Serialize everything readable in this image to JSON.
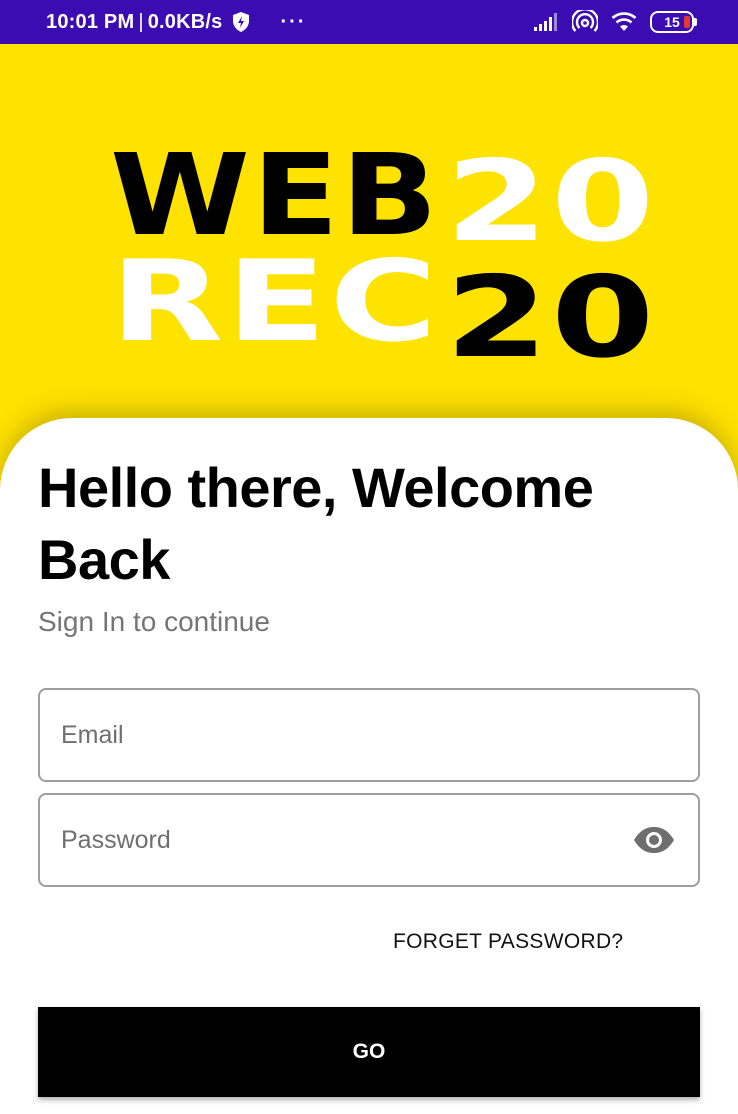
{
  "status_bar": {
    "time": "10:01 PM",
    "separator": "|",
    "speed": "0.0KB/s",
    "more": "···",
    "battery": "15"
  },
  "logo": {
    "line1_dark": "WEB",
    "line1_light": "20",
    "line2_light": "REC",
    "line2_dark": "20"
  },
  "login": {
    "heading": "Hello there, Welcome Back",
    "subtitle": "Sign In to continue",
    "email_placeholder": "Email",
    "password_placeholder": "Password",
    "forget_password": "FORGET PASSWORD?",
    "go_label": "GO"
  },
  "colors": {
    "background": "#FEE200",
    "status_bar": "#3A0CB2",
    "button": "#000000"
  },
  "icons": {
    "shield": "shield-icon",
    "signal": "signal-icon",
    "hotspot": "hotspot-icon",
    "wifi": "wifi-icon",
    "eye": "eye-icon"
  }
}
